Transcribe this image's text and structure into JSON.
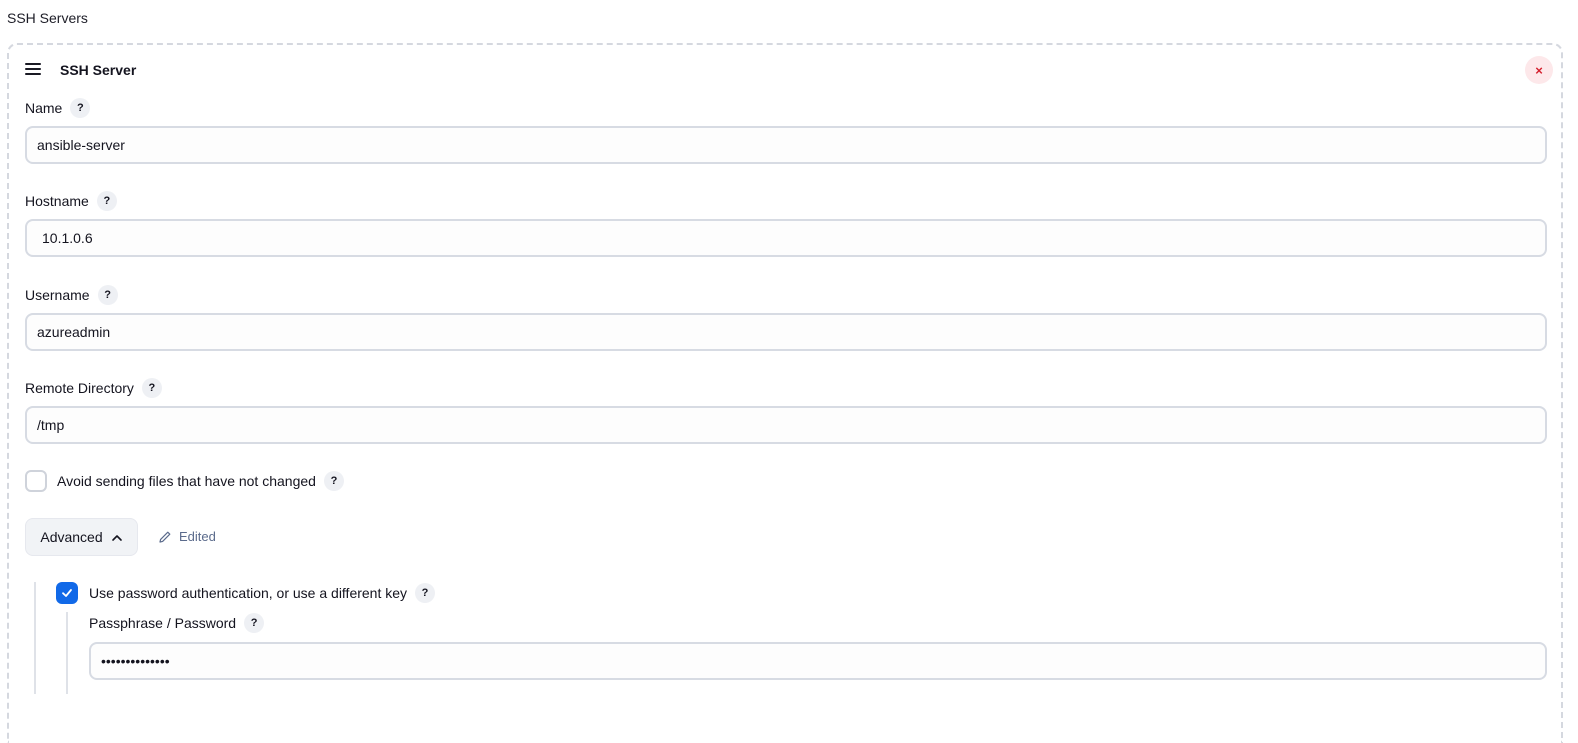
{
  "section": {
    "title": "SSH Servers"
  },
  "server": {
    "title": "SSH Server",
    "delete_symbol": "×",
    "name": {
      "label": "Name",
      "value": "ansible-server"
    },
    "hostname": {
      "label": "Hostname",
      "value": "10.1.0.6"
    },
    "username": {
      "label": "Username",
      "value": "azureadmin"
    },
    "remote_directory": {
      "label": "Remote Directory",
      "value": "/tmp"
    },
    "avoid_sending": {
      "label": "Avoid sending files that have not changed",
      "checked": false
    },
    "advanced": {
      "label": "Advanced",
      "edited_label": "Edited"
    },
    "use_password": {
      "label": "Use password authentication, or use a different key",
      "checked": true
    },
    "passphrase": {
      "label": "Passphrase / Password",
      "value": "••••••••••••••"
    }
  },
  "help_symbol": "?",
  "colors": {
    "accent": "#1169e8",
    "delete": "#d41f2d",
    "edited": "#5b6b8c"
  },
  "icons": [
    "hamburger-icon",
    "close-icon",
    "help-icon",
    "chevron-up-icon",
    "pencil-icon",
    "checkmark-icon"
  ]
}
